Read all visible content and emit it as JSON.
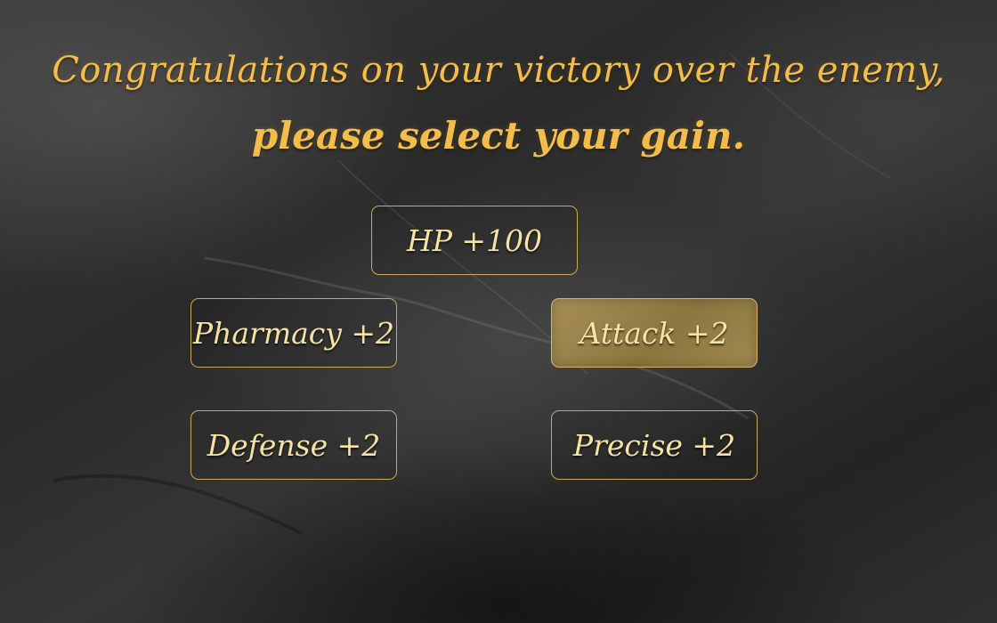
{
  "screen": {
    "title_line1": "Congratulations on your victory over the enemy,",
    "title_line2": "please select your gain.",
    "accent_color": "#f2bd4a",
    "selected_option_color": "#9e8649"
  },
  "options": [
    {
      "id": "hp",
      "label": "HP +100",
      "selected": false
    },
    {
      "id": "pharmacy",
      "label": "Pharmacy +2",
      "selected": false
    },
    {
      "id": "attack",
      "label": "Attack +2",
      "selected": true
    },
    {
      "id": "defense",
      "label": "Defense +2",
      "selected": false
    },
    {
      "id": "precise",
      "label": "Precise +2",
      "selected": false
    }
  ]
}
